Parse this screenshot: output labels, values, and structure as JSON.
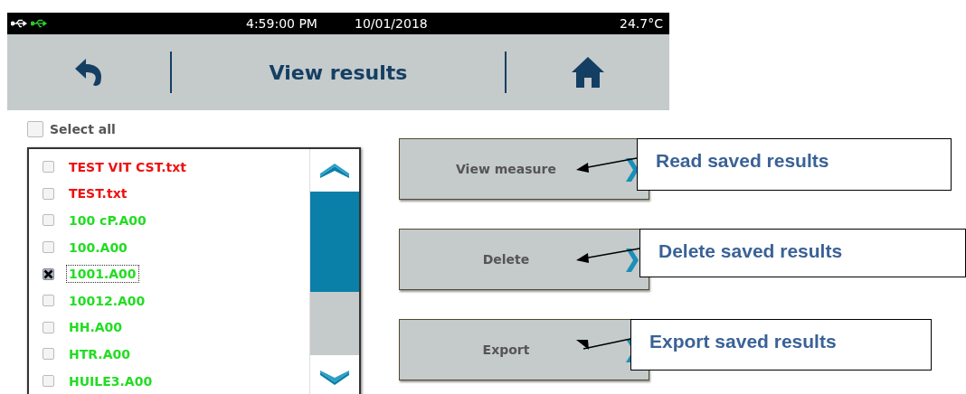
{
  "status_bar": {
    "time": "4:59:00 PM",
    "date": "10/01/2018",
    "temperature": "24.7°C"
  },
  "header": {
    "title": "View results"
  },
  "select_all": {
    "label": "Select all",
    "checked": false
  },
  "files": [
    {
      "name": "TEST VIT CST.txt",
      "color": "#ee1111",
      "checked": false,
      "selected": false
    },
    {
      "name": "TEST.txt",
      "color": "#ee1111",
      "checked": false,
      "selected": false
    },
    {
      "name": "100 cP.A00",
      "color": "#22dd22",
      "checked": false,
      "selected": false
    },
    {
      "name": "100.A00",
      "color": "#22dd22",
      "checked": false,
      "selected": false
    },
    {
      "name": "1001.A00",
      "color": "#22dd22",
      "checked": true,
      "selected": true
    },
    {
      "name": "10012.A00",
      "color": "#22dd22",
      "checked": false,
      "selected": false
    },
    {
      "name": "HH.A00",
      "color": "#22dd22",
      "checked": false,
      "selected": false
    },
    {
      "name": "HTR.A00",
      "color": "#22dd22",
      "checked": false,
      "selected": false
    },
    {
      "name": "HUILE3.A00",
      "color": "#22dd22",
      "checked": false,
      "selected": false
    }
  ],
  "actions": [
    {
      "label": "View measure",
      "annotation": "Read saved results"
    },
    {
      "label": "Delete",
      "annotation": "Delete saved results"
    },
    {
      "label": "Export",
      "annotation": "Export saved results"
    }
  ]
}
